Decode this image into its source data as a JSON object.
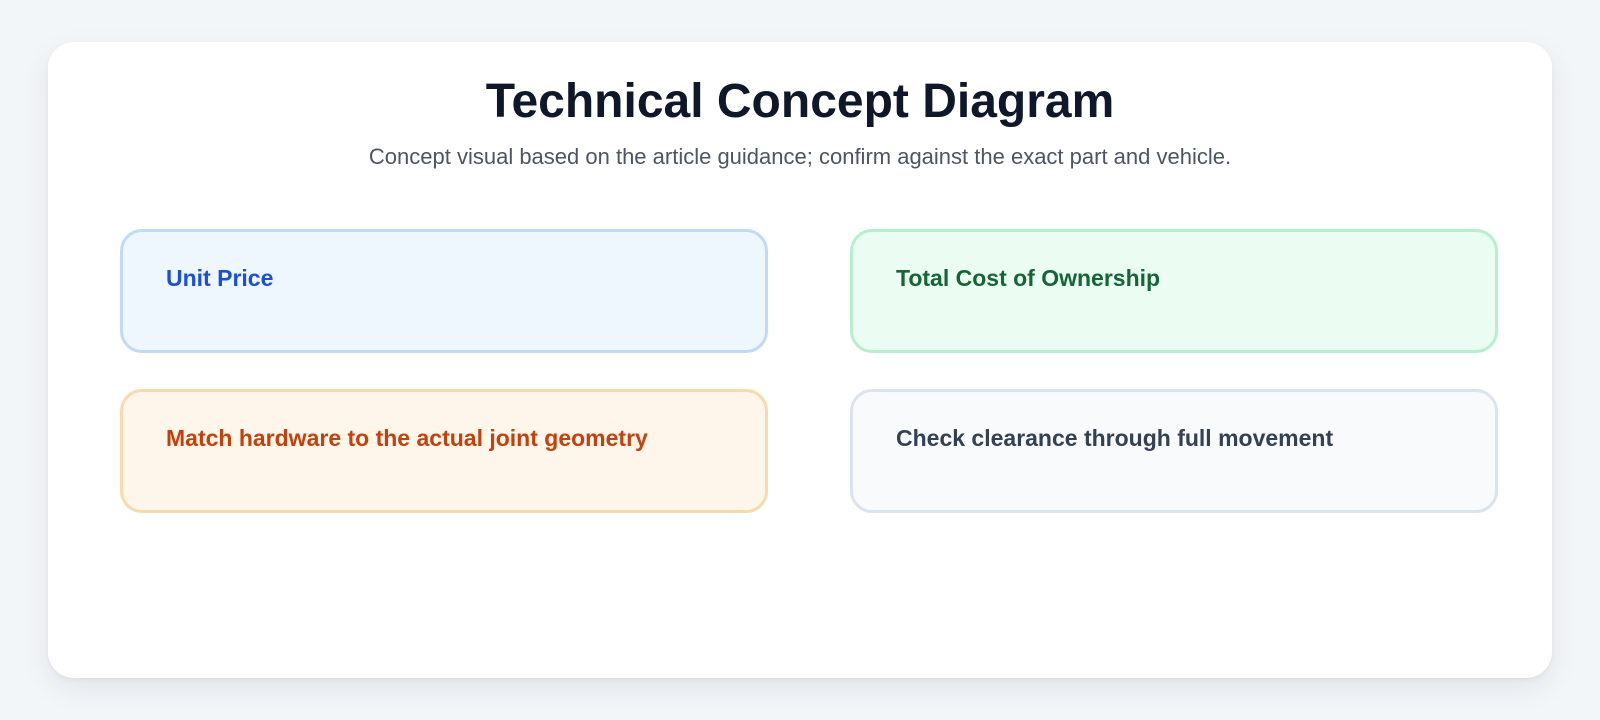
{
  "diagram": {
    "title": "Technical Concept Diagram",
    "subtitle": "Concept visual based on the article guidance; confirm against the exact part and vehicle.",
    "boxes": [
      {
        "label": "Unit Price",
        "text_color": "#1d4ed8",
        "background": "#eef6fe",
        "border": "#bfdaf7"
      },
      {
        "label": "Total Cost of Ownership",
        "text_color": "#166534",
        "background": "#ebfcf3",
        "border": "#b6efcf"
      },
      {
        "label": "Match hardware to the actual joint geometry",
        "text_color": "#c2410c",
        "background": "#fef6eb",
        "border": "#fad9ab"
      },
      {
        "label": "Check clearance through full movement",
        "text_color": "#334155",
        "background": "#f8fafc",
        "border": "#dbe3ec"
      }
    ]
  }
}
